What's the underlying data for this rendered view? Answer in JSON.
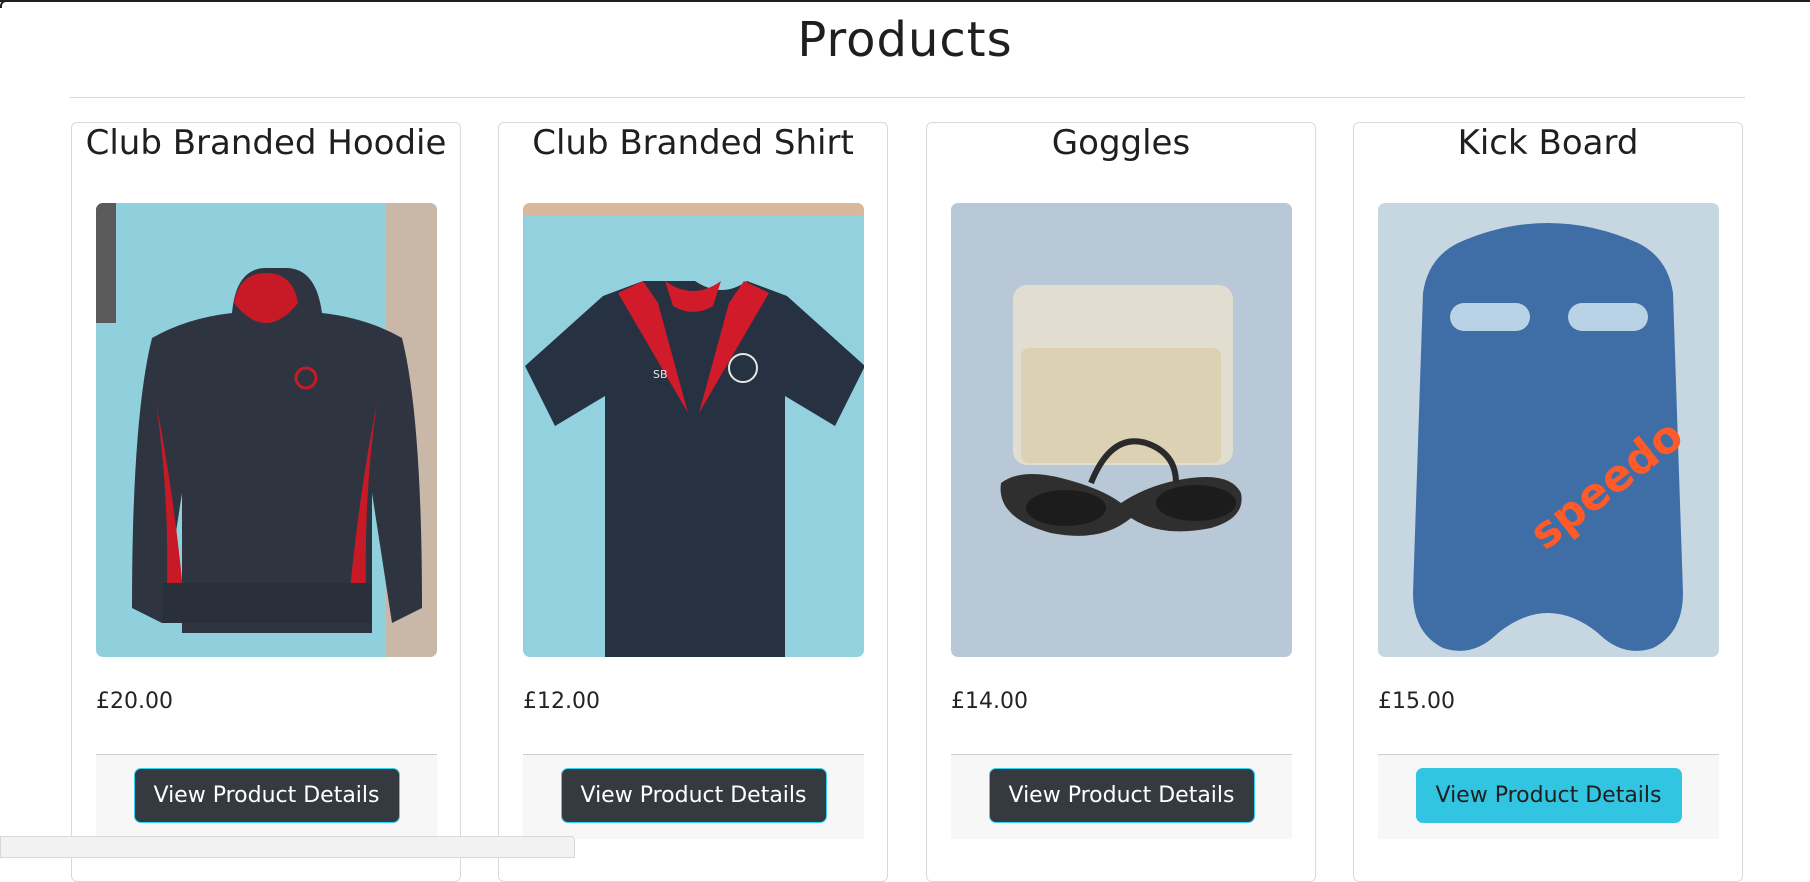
{
  "page": {
    "title": "Products"
  },
  "products": [
    {
      "name": "Club Branded Hoodie",
      "price": "£20.00",
      "button": "View Product Details"
    },
    {
      "name": "Club Branded Shirt",
      "price": "£12.00",
      "button": "View Product Details"
    },
    {
      "name": "Goggles",
      "price": "£14.00",
      "button": "View Product Details"
    },
    {
      "name": "Kick Board",
      "price": "£15.00",
      "button": "View Product Details"
    }
  ],
  "theme": {
    "dark_button": "#343a40",
    "hover_button": "#31c5e2",
    "accent_red": "#d11a2a",
    "speedo_orange": "#ff5a2a"
  }
}
